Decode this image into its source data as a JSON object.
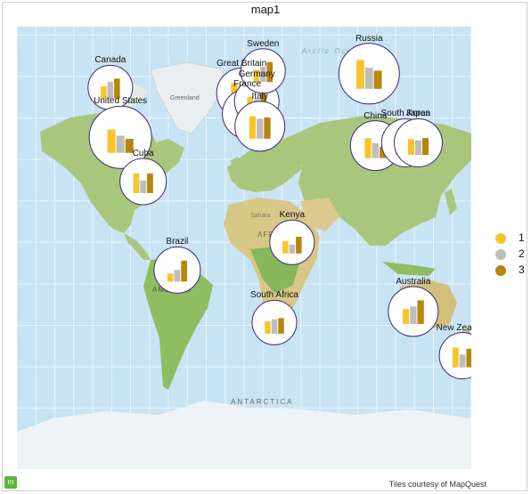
{
  "title": "map1",
  "credits": "Tiles courtesy of MapQuest",
  "map_labels": {
    "greenland": "Greenland",
    "africa": "AFRICA",
    "america": "AMERICA",
    "antarctica": "ANTARCTICA",
    "arctic": "Arctic Ocean",
    "sahara": "Sahara"
  },
  "colors": {
    "series1": "#f7c52b",
    "series2": "#bdbdbd",
    "series3": "#b8860b",
    "ocean": "#c8e3f4",
    "land": "#a8c87f",
    "marker_border": "#3a2a6e"
  },
  "legend": [
    {
      "label": "1",
      "color": "#f7c52b"
    },
    {
      "label": "2",
      "color": "#bdbdbd"
    },
    {
      "label": "3",
      "color": "#b8860b"
    }
  ],
  "chart_data": {
    "type": "bar",
    "series": [
      {
        "name": "1"
      },
      {
        "name": "2"
      },
      {
        "name": "3"
      }
    ],
    "markers": [
      {
        "country": "Canada",
        "lat": 56,
        "lon": -106,
        "size": 0.45,
        "values": [
          0.55,
          0.75,
          0.9
        ]
      },
      {
        "country": "United States",
        "lat": 38,
        "lon": -98,
        "size": 0.95,
        "values": [
          0.75,
          0.55,
          0.45
        ]
      },
      {
        "country": "Cuba",
        "lat": 22,
        "lon": -80,
        "size": 0.5,
        "values": [
          0.85,
          0.55,
          0.85
        ]
      },
      {
        "country": "Brazil",
        "lat": -10,
        "lon": -53,
        "size": 0.5,
        "values": [
          0.35,
          0.5,
          0.9
        ]
      },
      {
        "country": "Great Britain",
        "lat": 54,
        "lon": -2,
        "size": 0.6,
        "values": [
          0.9,
          0.8,
          0.6
        ]
      },
      {
        "country": "France",
        "lat": 46.5,
        "lon": 2.5,
        "size": 0.6,
        "values": [
          0.7,
          0.85,
          0.9
        ]
      },
      {
        "country": "Germany",
        "lat": 51,
        "lon": 10,
        "size": 0.45,
        "values": [
          0.7,
          0.6,
          0.85
        ]
      },
      {
        "country": "Sweden",
        "lat": 62,
        "lon": 15,
        "size": 0.45,
        "values": [
          0.55,
          0.7,
          0.9
        ]
      },
      {
        "country": "Italy",
        "lat": 42,
        "lon": 12.5,
        "size": 0.6,
        "values": [
          0.9,
          0.8,
          0.85
        ]
      },
      {
        "country": "Kenya",
        "lat": 0,
        "lon": 38,
        "size": 0.45,
        "values": [
          0.55,
          0.4,
          0.75
        ]
      },
      {
        "country": "South Africa",
        "lat": -29,
        "lon": 24,
        "size": 0.45,
        "values": [
          0.55,
          0.65,
          0.7
        ]
      },
      {
        "country": "Russia",
        "lat": 61,
        "lon": 99,
        "size": 0.9,
        "values": [
          0.95,
          0.7,
          0.6
        ]
      },
      {
        "country": "China",
        "lat": 35,
        "lon": 104,
        "size": 0.6,
        "values": [
          0.8,
          0.6,
          0.45
        ]
      },
      {
        "country": "South Korea",
        "lat": 36,
        "lon": 128,
        "size": 0.55,
        "values": [
          0.8,
          0.75,
          0.65
        ]
      },
      {
        "country": "Japan",
        "lat": 36,
        "lon": 138,
        "size": 0.55,
        "values": [
          0.65,
          0.6,
          0.7
        ]
      },
      {
        "country": "Australia",
        "lat": -25,
        "lon": 134,
        "size": 0.6,
        "values": [
          0.6,
          0.7,
          0.95
        ]
      },
      {
        "country": "New Zealand",
        "lat": -41,
        "lon": 173,
        "size": 0.5,
        "values": [
          0.85,
          0.55,
          0.8
        ]
      }
    ]
  }
}
